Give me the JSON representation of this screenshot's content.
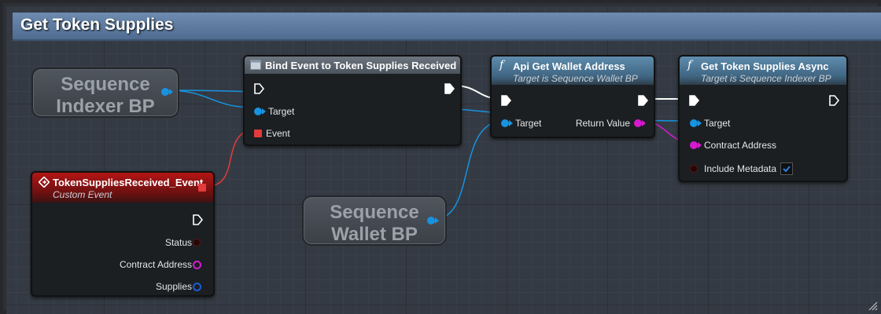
{
  "graph_title": "Get Token Supplies",
  "variables": {
    "indexer": {
      "line1": "Sequence",
      "line2": "Indexer BP"
    },
    "wallet": {
      "line1": "Sequence",
      "line2": "Wallet BP"
    }
  },
  "nodes": {
    "bind_event": {
      "title": "Bind Event to Token Supplies Received",
      "pins": {
        "target": "Target",
        "event": "Event"
      }
    },
    "custom_event": {
      "title": "TokenSuppliesReceived_Event",
      "subtitle": "Custom Event",
      "pins": {
        "status": "Status",
        "contract_address": "Contract Address",
        "supplies": "Supplies"
      }
    },
    "api_wallet": {
      "title": "Api Get Wallet Address",
      "subtitle": "Target is Sequence Wallet BP",
      "pins": {
        "target": "Target",
        "return_value": "Return Value"
      }
    },
    "token_supplies": {
      "title": "Get Token Supplies Async",
      "subtitle": "Target is Sequence Indexer BP",
      "pins": {
        "target": "Target",
        "contract_address": "Contract Address",
        "include_metadata": "Include Metadata"
      },
      "include_metadata_checked": true
    }
  },
  "colors": {
    "object_pin": "#1793e0",
    "string_pin": "#d51ad0",
    "delegate_pin": "#e33b3b",
    "function_header": "#4a7494",
    "event_header": "#9c1414"
  }
}
